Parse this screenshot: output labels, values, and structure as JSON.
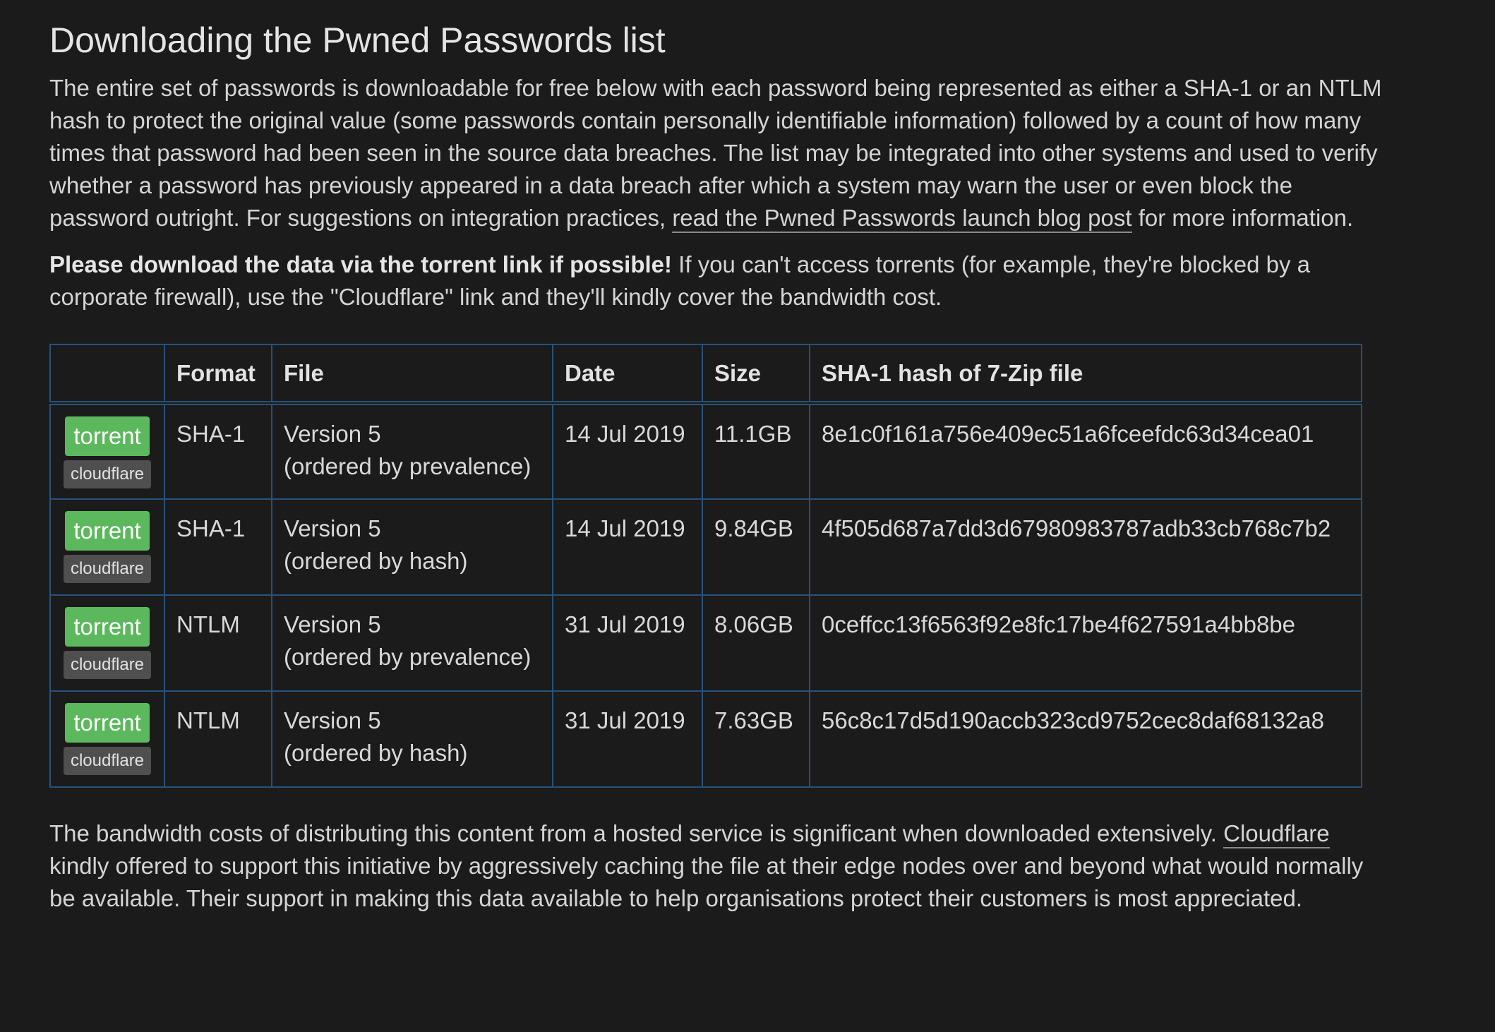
{
  "heading": "Downloading the Pwned Passwords list",
  "intro": {
    "text_before_link": "The entire set of passwords is downloadable for free below with each password being represented as either a SHA-1 or an NTLM hash to protect the original value (some passwords contain personally identifiable information) followed by a count of how many times that password had been seen in the source data breaches. The list may be integrated into other systems and used to verify whether a password has previously appeared in a data breach after which a system may warn the user or even block the password outright. For suggestions on integration practices, ",
    "link_text": "read the Pwned Passwords launch blog post",
    "text_after_link": " for more information."
  },
  "notice": {
    "bold": "Please download the data via the torrent link if possible!",
    "rest": " If you can't access torrents (for example, they're blocked by a corporate firewall), use the \"Cloudflare\" link and they'll kindly cover the bandwidth cost."
  },
  "table": {
    "headers": {
      "buttons": "",
      "format": "Format",
      "file": "File",
      "date": "Date",
      "size": "Size",
      "hash": "SHA-1 hash of 7-Zip file"
    },
    "rows": [
      {
        "torrent_label": "torrent",
        "cloudflare_label": "cloudflare",
        "format": "SHA-1",
        "file_line1": "Version 5",
        "file_line2": "(ordered by prevalence)",
        "date": "14 Jul 2019",
        "size": "11.1GB",
        "hash": "8e1c0f161a756e409ec51a6fceefdc63d34cea01"
      },
      {
        "torrent_label": "torrent",
        "cloudflare_label": "cloudflare",
        "format": "SHA-1",
        "file_line1": "Version 5",
        "file_line2": "(ordered by hash)",
        "date": "14 Jul 2019",
        "size": "9.84GB",
        "hash": "4f505d687a7dd3d67980983787adb33cb768c7b2"
      },
      {
        "torrent_label": "torrent",
        "cloudflare_label": "cloudflare",
        "format": "NTLM",
        "file_line1": "Version 5",
        "file_line2": "(ordered by prevalence)",
        "date": "31 Jul 2019",
        "size": "8.06GB",
        "hash": "0ceffcc13f6563f92e8fc17be4f627591a4bb8be"
      },
      {
        "torrent_label": "torrent",
        "cloudflare_label": "cloudflare",
        "format": "NTLM",
        "file_line1": "Version 5",
        "file_line2": "(ordered by hash)",
        "date": "31 Jul 2019",
        "size": "7.63GB",
        "hash": "56c8c17d5d190accb323cd9752cec8daf68132a8"
      }
    ]
  },
  "outro": {
    "text_before_link": "The bandwidth costs of distributing this content from a hosted service is significant when downloaded extensively. ",
    "link_text": "Cloudflare",
    "text_after_link": " kindly offered to support this initiative by aggressively caching the file at their edge nodes over and beyond what would normally be available. Their support in making this data available to help organisations protect their customers is most appreciated."
  },
  "colors": {
    "background": "#1b1b1b",
    "text": "#d4d4d4",
    "table_border": "#27527a",
    "torrent_button": "#5cb85c",
    "cloudflare_button": "#4f4f4f"
  }
}
